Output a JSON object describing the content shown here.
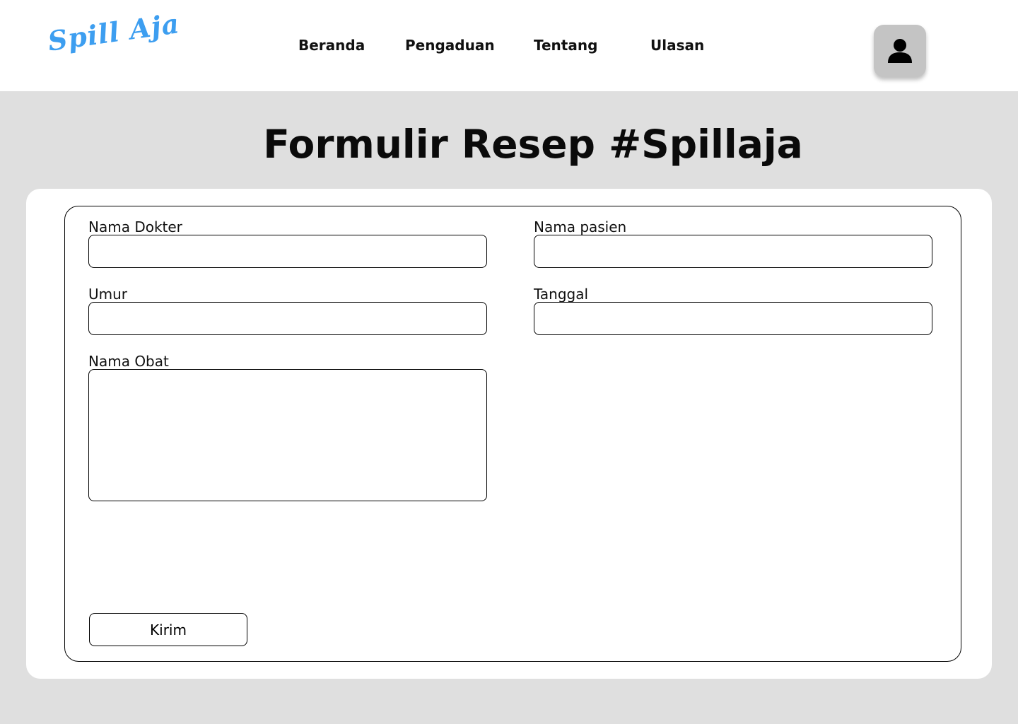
{
  "header": {
    "logo_text": "Spill Aja",
    "nav": [
      {
        "label": "Beranda"
      },
      {
        "label": "Pengaduan"
      },
      {
        "label": "Tentang"
      },
      {
        "label": "Ulasan"
      }
    ],
    "profile_icon": "user-icon"
  },
  "main": {
    "title": "Formulir Resep #Spillaja",
    "form": {
      "doctor_name": {
        "label": "Nama Dokter",
        "value": ""
      },
      "patient_name": {
        "label": "Nama pasien",
        "value": ""
      },
      "age": {
        "label": "Umur",
        "value": ""
      },
      "date": {
        "label": "Tanggal",
        "value": ""
      },
      "medicine_name": {
        "label": "Nama Obat",
        "value": ""
      },
      "submit_label": "Kirim"
    }
  },
  "colors": {
    "page_background": "#dfdfdf",
    "logo": "#3d9ef0",
    "profile_button": "#c4c4c4"
  }
}
